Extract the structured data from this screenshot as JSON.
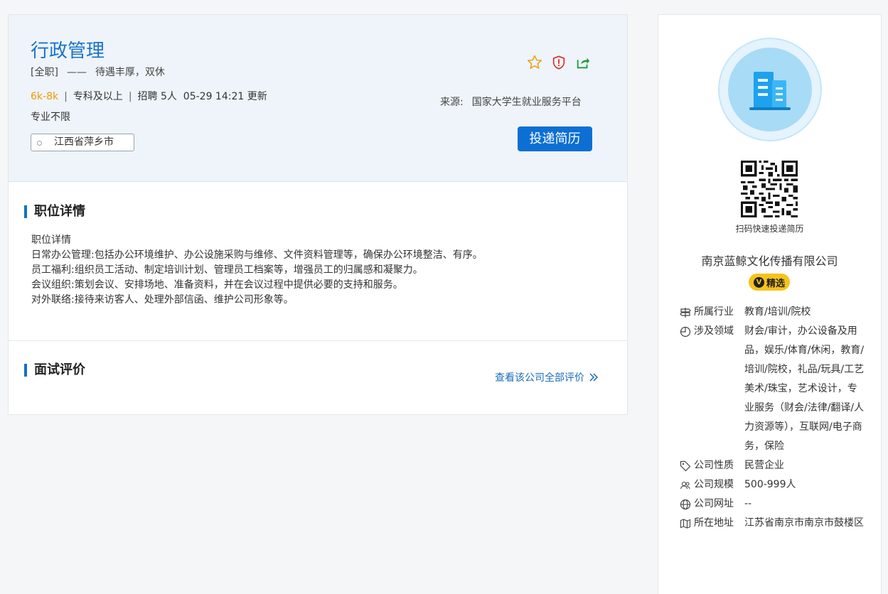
{
  "job": {
    "title": "行政管理",
    "type": "[全职]",
    "dash": "——",
    "benefit": "待遇丰厚，双休",
    "salary": "6k-8k",
    "sep": "|",
    "education": "专科及以上",
    "recruit": "招聘 5人",
    "updated": "05-29 14:21 更新",
    "major": "专业不限",
    "location": "江西省萍乡市",
    "source_label": "来源:",
    "source": "国家大学生就业服务平台",
    "apply_label": "投递简历"
  },
  "icons": {
    "favorite": "star-icon",
    "report": "shield-alert-icon",
    "share": "share-icon"
  },
  "detail": {
    "title": "职位详情",
    "lines": [
      "职位详情",
      "日常办公管理:包括办公环境维护、办公设施采购与维修、文件资料管理等，确保办公环境整洁、有序。",
      "员工福利:组织员工活动、制定培训计划、管理员工档案等，增强员工的归属感和凝聚力。",
      "会议组织:策划会议、安排场地、准备资料，并在会议过程中提供必要的支持和服务。",
      "对外联络:接待来访客人、处理外部信函、维护公司形象等。"
    ]
  },
  "review": {
    "title": "面试评价",
    "link": "查看该公司全部评价"
  },
  "company": {
    "qr_caption": "扫码快速投递简历",
    "name": "南京蓝鲸文化传播有限公司",
    "badge_v": "V",
    "badge": "精选",
    "info": [
      {
        "icon": "signpost-icon",
        "label": "所属行业",
        "value": "教育/培训/院校"
      },
      {
        "icon": "pie-chart-icon",
        "label": "涉及领域",
        "value": "财会/审计，办公设备及用品，娱乐/体育/休闲，教育/培训/院校，礼品/玩具/工艺美术/珠宝，艺术设计，专业服务（财会/法律/翻译/人力资源等），互联网/电子商务，保险"
      },
      {
        "icon": "tag-icon",
        "label": "公司性质",
        "value": "民营企业"
      },
      {
        "icon": "people-icon",
        "label": "公司规模",
        "value": "500-999人"
      },
      {
        "icon": "globe-icon",
        "label": "公司网址",
        "value": "--"
      },
      {
        "icon": "map-icon",
        "label": "所在地址",
        "value": "江苏省南京市南京市鼓楼区"
      }
    ]
  },
  "colors": {
    "accent": "#1874c6",
    "salary": "#f39800",
    "button": "#0d6fd3",
    "badge": "#f6c31c"
  }
}
